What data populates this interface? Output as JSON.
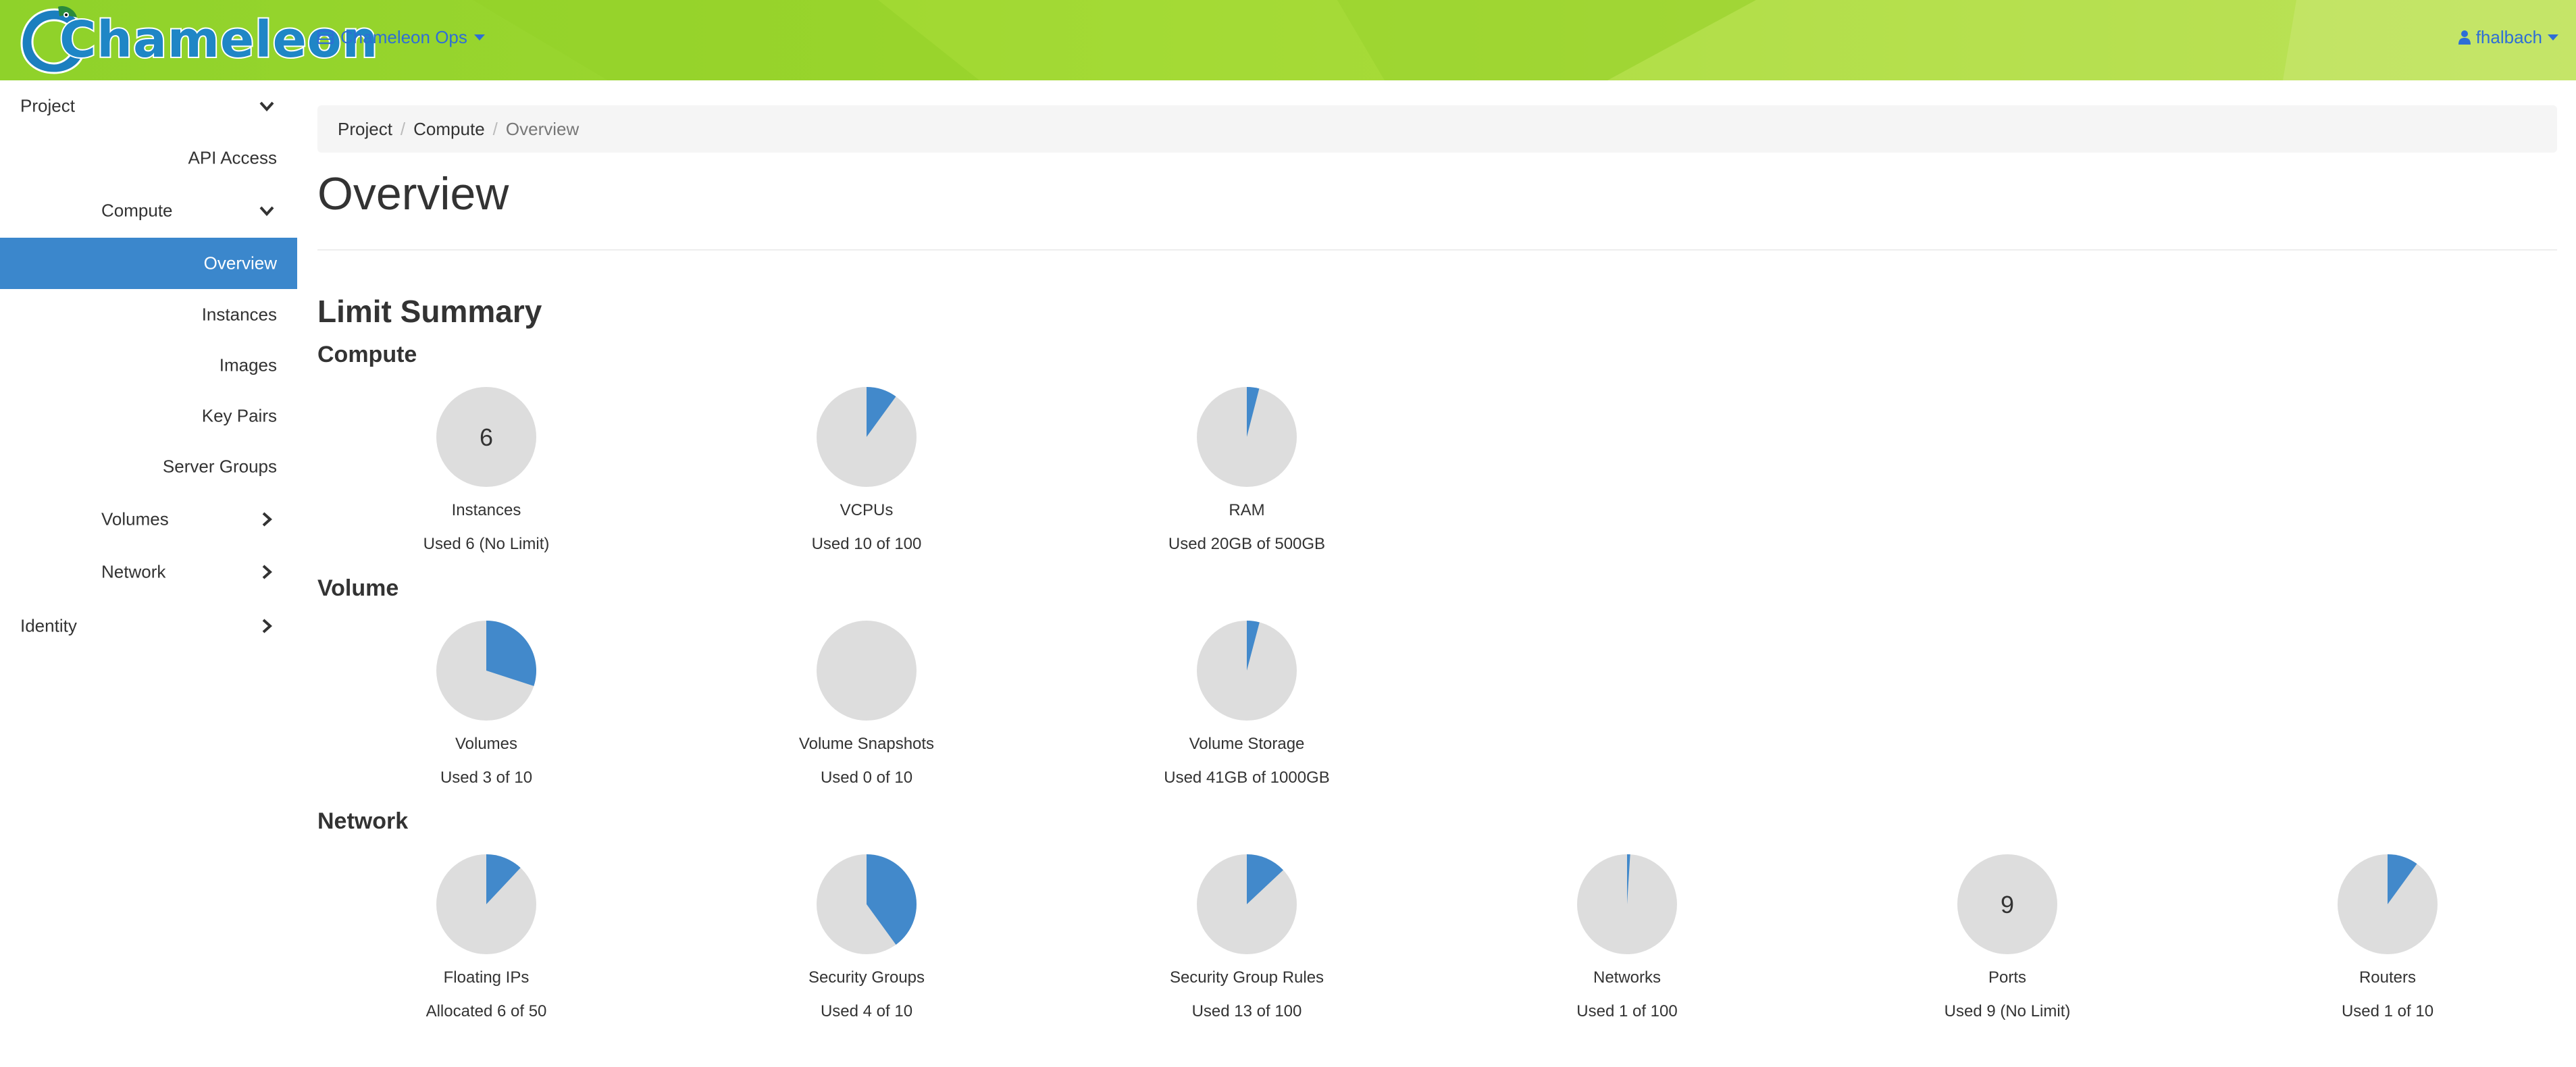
{
  "brand": {
    "name": "Chameleon"
  },
  "colors": {
    "navbar_green": "#9ed730",
    "link_blue": "#2e6ed6",
    "active_blue": "#3b87cc",
    "pie_used": "#4289cb",
    "pie_empty": "#dddddd"
  },
  "header": {
    "project_switcher": {
      "icon": "project-table-icon",
      "label": "Chameleon Ops"
    },
    "user_menu": {
      "icon": "user-icon",
      "label": "fhalbach"
    }
  },
  "sidebar": {
    "items": [
      {
        "label": "Project",
        "level": 0,
        "expandable": true,
        "expanded": true
      },
      {
        "label": "API Access",
        "level": 1
      },
      {
        "label": "Compute",
        "level": 1,
        "expandable": true,
        "expanded": true
      },
      {
        "label": "Overview",
        "level": 2,
        "active": true
      },
      {
        "label": "Instances",
        "level": 2
      },
      {
        "label": "Images",
        "level": 2
      },
      {
        "label": "Key Pairs",
        "level": 2
      },
      {
        "label": "Server Groups",
        "level": 2
      },
      {
        "label": "Volumes",
        "level": 1,
        "expandable": true,
        "expanded": false
      },
      {
        "label": "Network",
        "level": 1,
        "expandable": true,
        "expanded": false
      },
      {
        "label": "Identity",
        "level": 0,
        "expandable": true,
        "expanded": false
      }
    ]
  },
  "breadcrumb": [
    "Project",
    "Compute",
    "Overview"
  ],
  "page": {
    "title": "Overview",
    "limit_summary_title": "Limit Summary"
  },
  "sections": [
    {
      "title": "Compute",
      "gauges": [
        {
          "label": "Instances",
          "usage": "Used 6 (No Limit)",
          "used": 6,
          "limit": null,
          "center_text": "6"
        },
        {
          "label": "VCPUs",
          "usage": "Used 10 of 100",
          "used": 10,
          "limit": 100
        },
        {
          "label": "RAM",
          "usage": "Used 20GB of 500GB",
          "used": 20,
          "limit": 500
        }
      ]
    },
    {
      "title": "Volume",
      "gauges": [
        {
          "label": "Volumes",
          "usage": "Used 3 of 10",
          "used": 3,
          "limit": 10
        },
        {
          "label": "Volume Snapshots",
          "usage": "Used 0 of 10",
          "used": 0,
          "limit": 10
        },
        {
          "label": "Volume Storage",
          "usage": "Used 41GB of 1000GB",
          "used": 41,
          "limit": 1000
        }
      ]
    },
    {
      "title": "Network",
      "gauges": [
        {
          "label": "Floating IPs",
          "usage": "Allocated 6 of 50",
          "used": 6,
          "limit": 50
        },
        {
          "label": "Security Groups",
          "usage": "Used 4 of 10",
          "used": 4,
          "limit": 10
        },
        {
          "label": "Security Group Rules",
          "usage": "Used 13 of 100",
          "used": 13,
          "limit": 100
        },
        {
          "label": "Networks",
          "usage": "Used 1 of 100",
          "used": 1,
          "limit": 100
        },
        {
          "label": "Ports",
          "usage": "Used 9 (No Limit)",
          "used": 9,
          "limit": null,
          "center_text": "9"
        },
        {
          "label": "Routers",
          "usage": "Used 1 of 10",
          "used": 1,
          "limit": 10
        }
      ]
    }
  ]
}
